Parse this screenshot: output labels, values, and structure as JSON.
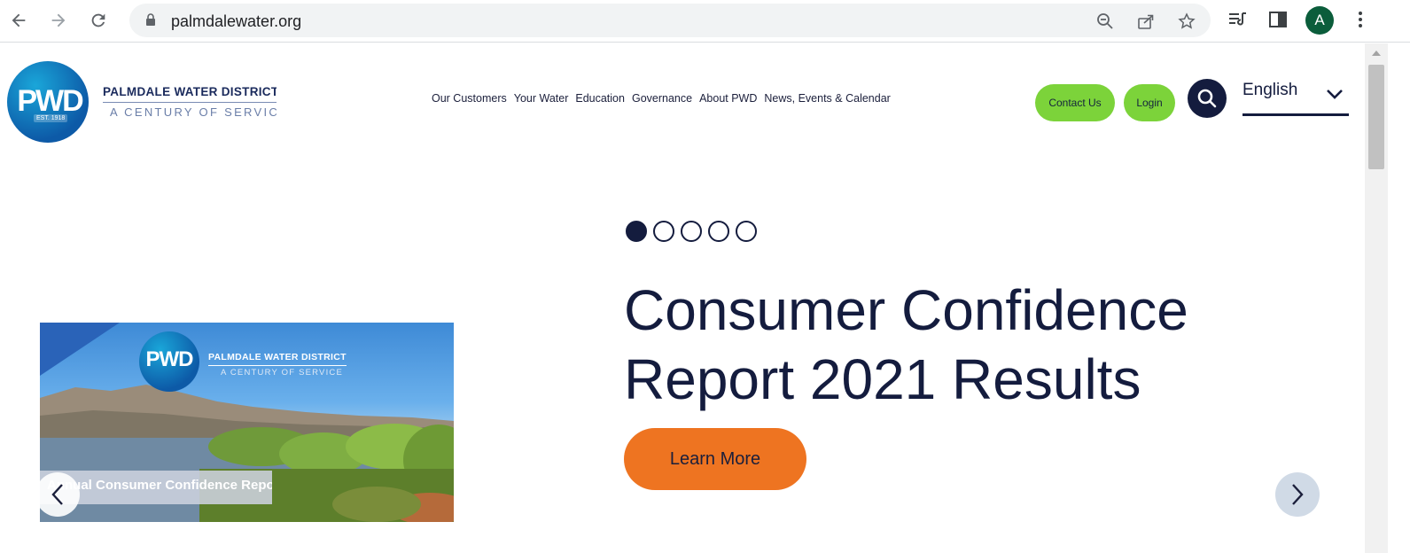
{
  "browser": {
    "url": "palmdalewater.org",
    "avatar_initial": "A"
  },
  "site": {
    "logo_text": "PWD",
    "logo_est": "EST. 1918",
    "name": "PALMDALE WATER DISTRICT",
    "tagline": "A CENTURY OF SERVICE",
    "nav": [
      "Our Customers",
      "Your Water",
      "Education",
      "Governance",
      "About PWD",
      "News, Events & Calendar"
    ],
    "contact_label": "Contact Us",
    "login_label": "Login",
    "language": "English"
  },
  "hero": {
    "slide_count": 5,
    "active_slide": 1,
    "headline": "Consumer Confidence Report 2021 Results",
    "cta_label": "Learn More",
    "image_logo_text": "PWD",
    "image_org_name": "PALMDALE WATER DISTRICT",
    "image_tagline": "A CENTURY OF SERVICE",
    "image_caption": "Annual Consumer Confidence Report"
  },
  "colors": {
    "navy": "#141c3e",
    "green": "#7cd33a",
    "orange": "#ee7421"
  }
}
